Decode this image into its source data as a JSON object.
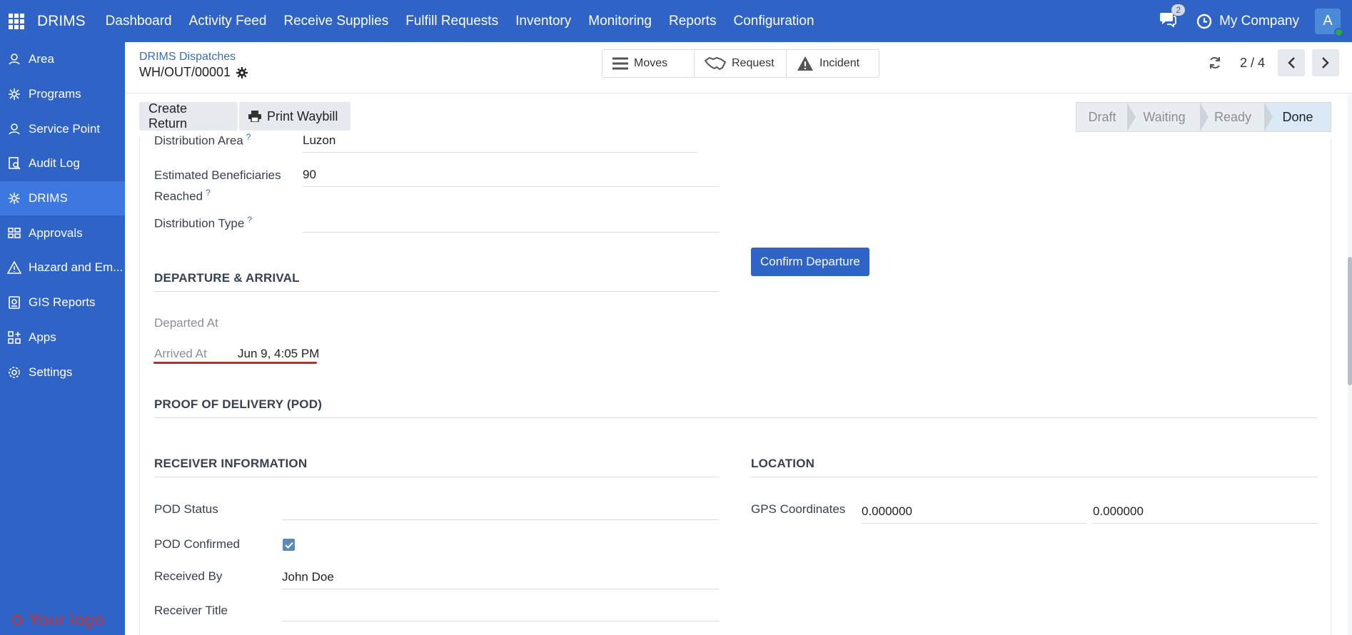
{
  "topbar": {
    "brand": "DRIMS",
    "menu": [
      "Dashboard",
      "Activity Feed",
      "Receive Supplies",
      "Fulfill Requests",
      "Inventory",
      "Monitoring",
      "Reports",
      "Configuration"
    ],
    "chat_count": "2",
    "company": "My Company",
    "avatar_letter": "A"
  },
  "sidebar": {
    "items": [
      {
        "label": "Area",
        "icon": "area-icon"
      },
      {
        "label": "Programs",
        "icon": "programs-icon"
      },
      {
        "label": "Service Point",
        "icon": "service-point-icon"
      },
      {
        "label": "Audit Log",
        "icon": "audit-log-icon"
      },
      {
        "label": "DRIMS",
        "icon": "drims-icon"
      },
      {
        "label": "Approvals",
        "icon": "approvals-icon"
      },
      {
        "label": "Hazard and Em...",
        "icon": "hazard-icon"
      },
      {
        "label": "GIS Reports",
        "icon": "gis-icon"
      },
      {
        "label": "Apps",
        "icon": "apps-icon"
      },
      {
        "label": "Settings",
        "icon": "settings-icon"
      }
    ],
    "logo_text": "Your logo"
  },
  "header": {
    "breadcrumb_parent": "DRIMS Dispatches",
    "record_name": "WH/OUT/00001",
    "smart_buttons": {
      "moves": "Moves",
      "request": "Request",
      "incident": "Incident"
    },
    "pager": "2 / 4"
  },
  "actions": {
    "create_return": "Create Return",
    "print_waybill": "Print Waybill"
  },
  "status": {
    "stages": [
      "Draft",
      "Waiting",
      "Ready",
      "Done"
    ],
    "current": "Done"
  },
  "form": {
    "distribution_area_label": "Distribution Area",
    "distribution_area_value": "Luzon",
    "beneficiaries_label_1": "Estimated Beneficiaries",
    "beneficiaries_label_2": "Reached",
    "beneficiaries_value": "90",
    "distribution_type_label": "Distribution Type",
    "confirm_departure": "Confirm Departure",
    "departure_section": "DEPARTURE & ARRIVAL",
    "departed_at_label": "Departed At",
    "arrived_at_label": "Arrived At",
    "arrived_at_value": "Jun 9, 4:05 PM",
    "pod_section": "PROOF OF DELIVERY (POD)",
    "receiver_section": "RECEIVER INFORMATION",
    "location_section": "LOCATION",
    "pod_status_label": "POD Status",
    "pod_confirmed_label": "POD Confirmed",
    "pod_confirmed": true,
    "received_by_label": "Received By",
    "received_by_value": "John Doe",
    "receiver_title_label": "Receiver Title",
    "gps_label": "GPS Coordinates",
    "gps_lat": "0.000000",
    "gps_lng": "0.000000"
  },
  "colors": {
    "brand": "#2f63c5",
    "annotation": "#e31c1c"
  }
}
